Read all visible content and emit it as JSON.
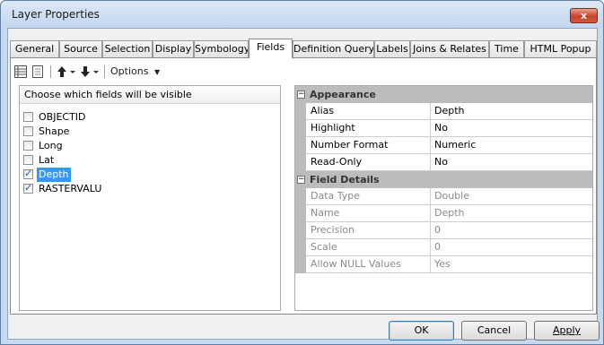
{
  "window": {
    "title": "Layer Properties",
    "close_label": "x"
  },
  "tabs": [
    {
      "label": "General"
    },
    {
      "label": "Source"
    },
    {
      "label": "Selection"
    },
    {
      "label": "Display"
    },
    {
      "label": "Symbology"
    },
    {
      "label": "Fields"
    },
    {
      "label": "Definition Query"
    },
    {
      "label": "Labels"
    },
    {
      "label": "Joins & Relates"
    },
    {
      "label": "Time"
    },
    {
      "label": "HTML Popup"
    }
  ],
  "active_tab": "Fields",
  "toolbar": {
    "icons": [
      "table-view-icon",
      "list-view-icon",
      "move-up-icon",
      "move-down-icon"
    ],
    "options_label": "Options"
  },
  "fields": {
    "header": "Choose which fields will be visible",
    "items": [
      {
        "name": "OBJECTID",
        "checked": false,
        "selected": false
      },
      {
        "name": "Shape",
        "checked": false,
        "selected": false
      },
      {
        "name": "Long",
        "checked": false,
        "selected": false
      },
      {
        "name": "Lat",
        "checked": false,
        "selected": false
      },
      {
        "name": "Depth",
        "checked": true,
        "selected": true
      },
      {
        "name": "RASTERVALU",
        "checked": true,
        "selected": false
      }
    ]
  },
  "properties": {
    "appearance": {
      "title": "Appearance",
      "rows": [
        {
          "name": "Alias",
          "value": "Depth"
        },
        {
          "name": "Highlight",
          "value": "No"
        },
        {
          "name": "Number Format",
          "value": "Numeric"
        },
        {
          "name": "Read-Only",
          "value": "No"
        }
      ]
    },
    "field_details": {
      "title": "Field Details",
      "rows": [
        {
          "name": "Data Type",
          "value": "Double"
        },
        {
          "name": "Name",
          "value": "Depth"
        },
        {
          "name": "Precision",
          "value": "0"
        },
        {
          "name": "Scale",
          "value": "0"
        },
        {
          "name": "Allow NULL Values",
          "value": "Yes"
        }
      ]
    }
  },
  "buttons": {
    "ok": "OK",
    "cancel": "Cancel",
    "apply": "Apply"
  }
}
